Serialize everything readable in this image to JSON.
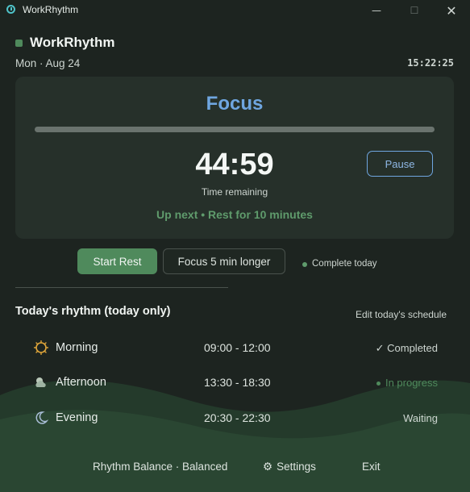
{
  "window": {
    "title": "WorkRhythm",
    "controls": {
      "minimize": "—",
      "maximize": "☐",
      "close": "✕"
    }
  },
  "header": {
    "title": "WorkRhythm",
    "date": "Mon · Aug 24",
    "clock": "15:22:25"
  },
  "focus_card": {
    "mode": "Focus",
    "progress_fraction": 1.0,
    "timer": "44:59",
    "timer_caption": "Time remaining",
    "up_next": "Up next • Rest for 10 minutes",
    "pause_label": "Pause"
  },
  "actions": {
    "start_rest_label": "Start Rest",
    "extend_label": "Focus 5 min longer",
    "complete_label": "Complete today"
  },
  "schedule": {
    "title": "Today's rhythm (today only)",
    "edit_label": "Edit today's schedule",
    "rows": [
      {
        "name": "Morning",
        "time": "09:00 - 12:00",
        "status": "✓ Completed",
        "icon": "sun-icon"
      },
      {
        "name": "Afternoon",
        "time": "13:30 - 18:30",
        "status": "In progress",
        "icon": "cloud-sun-icon"
      },
      {
        "name": "Evening",
        "time": "20:30 - 22:30",
        "status": "Waiting",
        "icon": "moon-icon"
      }
    ]
  },
  "footer": {
    "balance": "Rhythm Balance · Balanced",
    "settings": "Settings",
    "exit": "Exit"
  },
  "colors": {
    "background": "#1d2420",
    "card": "#26302a",
    "accent_green": "#4f8a5c",
    "accent_blue": "#6fa6e0",
    "wave": "#2a4632"
  }
}
